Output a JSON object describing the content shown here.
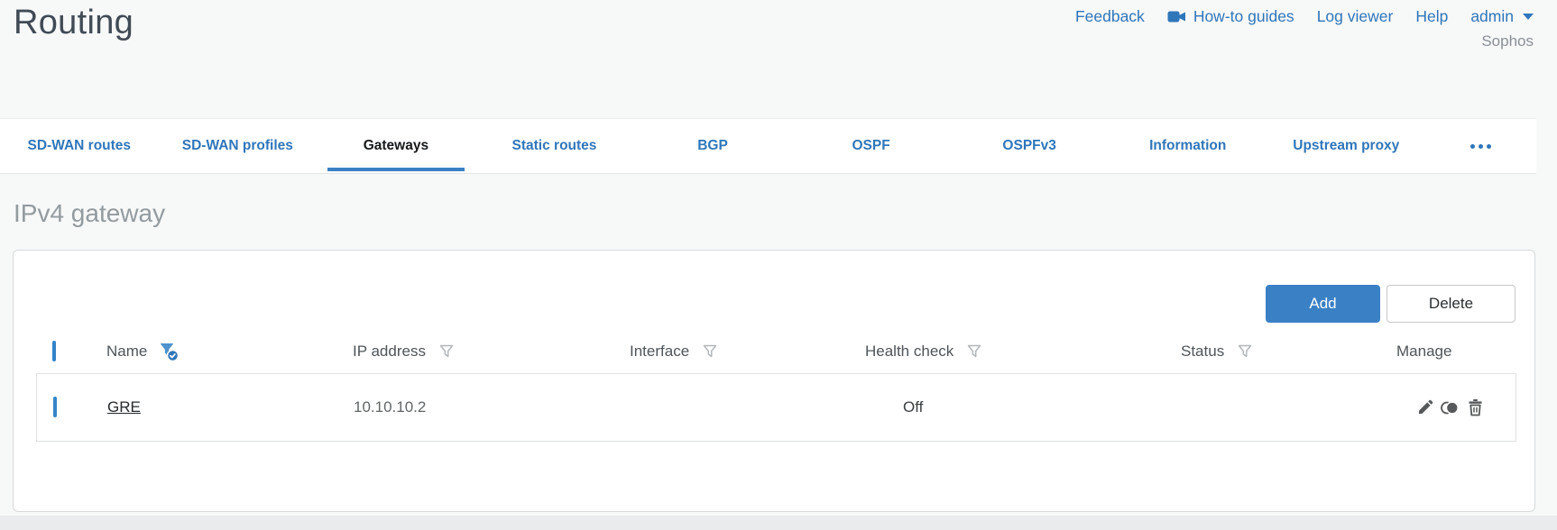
{
  "page": {
    "title": "Routing",
    "brand": "Sophos",
    "section_title": "IPv4 gateway"
  },
  "header": {
    "links": [
      {
        "label": "Feedback"
      },
      {
        "label": "How-to guides",
        "icon": "video-camera-icon"
      },
      {
        "label": "Log viewer"
      },
      {
        "label": "Help"
      }
    ],
    "user_menu": {
      "label": "admin",
      "icon": "chevron-down-icon"
    }
  },
  "tabs": [
    {
      "label": "SD-WAN routes",
      "active": false
    },
    {
      "label": "SD-WAN profiles",
      "active": false
    },
    {
      "label": "Gateways",
      "active": true
    },
    {
      "label": "Static routes",
      "active": false
    },
    {
      "label": "BGP",
      "active": false
    },
    {
      "label": "OSPF",
      "active": false
    },
    {
      "label": "OSPFv3",
      "active": false
    },
    {
      "label": "Information",
      "active": false
    },
    {
      "label": "Upstream proxy",
      "active": false
    },
    {
      "label": "",
      "icon": "ellipsis-icon",
      "active": false
    }
  ],
  "toolbar": {
    "add_label": "Add",
    "delete_label": "Delete"
  },
  "table": {
    "columns": [
      {
        "label": "Name",
        "filter": "active"
      },
      {
        "label": "IP address",
        "filter": "inactive"
      },
      {
        "label": "Interface",
        "filter": "inactive"
      },
      {
        "label": "Health check",
        "filter": "inactive"
      },
      {
        "label": "Status",
        "filter": "inactive"
      },
      {
        "label": "Manage",
        "filter": "none"
      }
    ],
    "rows": [
      {
        "name": "GRE",
        "ip_address": "10.10.10.2",
        "interface": "",
        "health_check": "Off",
        "status": "green",
        "manage": [
          "edit",
          "clone",
          "delete"
        ]
      }
    ]
  },
  "colors": {
    "accent_blue": "#2f76ba",
    "button_blue": "#3a80c4",
    "status_green": "#85c440",
    "active_tab_text": "#16181a",
    "title_gray": "#414b56",
    "section_gray": "#939b9f"
  }
}
